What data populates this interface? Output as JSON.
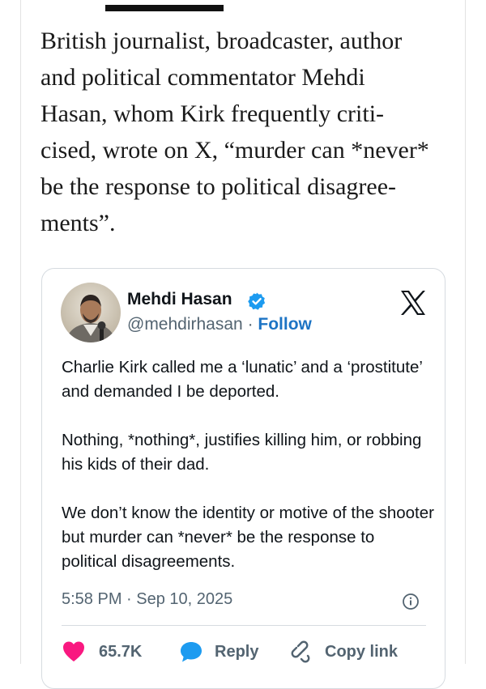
{
  "article": {
    "paragraph_lines": [
      "British journalist, broadcaster, author",
      "and political commentator Mehdi",
      "Hasan, whom Kirk frequently criti-",
      "cised, wrote on X, “murder can *never*",
      "be the response to political disagree-",
      "ments”."
    ]
  },
  "tweet": {
    "author_name": "Mehdi Hasan",
    "handle": "@mehdirhasan",
    "separator": " · ",
    "follow_label": "Follow",
    "paragraphs": [
      "Charlie Kirk called me a ‘lunatic’ and a ‘prostitute’ and demanded I be deported.",
      "Nothing, *nothing*, justifies killing him, or robbing his kids of their dad.",
      "We don’t know the identity or motive of the shooter but murder can *never* be the response to political disagreements."
    ],
    "timestamp": "5:58 PM · Sep 10, 2025",
    "actions": {
      "like_count": "65.7K",
      "reply_label": "Reply",
      "copy_link_label": "Copy link"
    }
  },
  "icons": {
    "verified": "verified-badge-icon",
    "platform": "x-logo-icon",
    "info": "info-icon",
    "like": "heart-icon",
    "reply": "speech-bubble-icon",
    "link": "link-icon"
  },
  "colors": {
    "follow_link": "#1d74c4",
    "verified_badge": "#1d9bf0",
    "like_heart": "#f91880",
    "reply_bubble": "#1d9bf0",
    "meta_text": "#536471"
  }
}
